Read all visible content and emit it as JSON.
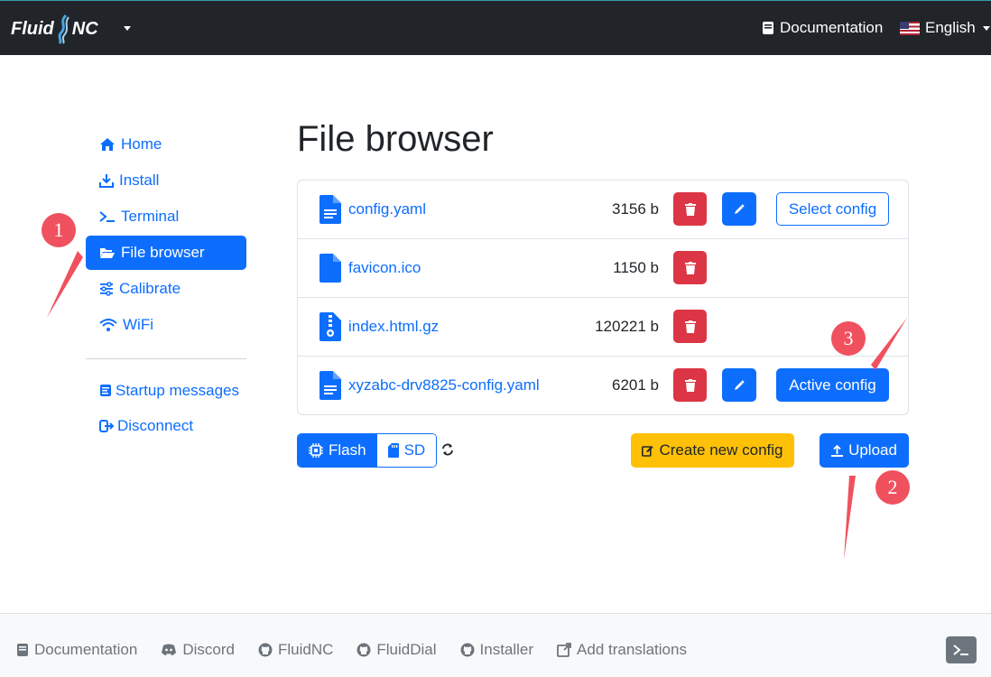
{
  "navbar": {
    "brand": "Fluid NC",
    "documentation": "Documentation",
    "language": "English",
    "icons": {
      "doc": "book-icon",
      "flag": "us-flag-icon"
    }
  },
  "sidebar": {
    "items": [
      {
        "label": "Home",
        "icon": "home-icon"
      },
      {
        "label": "Install",
        "icon": "download-icon"
      },
      {
        "label": "Terminal",
        "icon": "terminal-icon"
      },
      {
        "label": "File browser",
        "icon": "folder-open-icon",
        "active": true
      },
      {
        "label": "Calibrate",
        "icon": "sliders-icon"
      },
      {
        "label": "WiFi",
        "icon": "wifi-icon"
      }
    ],
    "startup": "Startup messages",
    "disconnect": "Disconnect"
  },
  "page": {
    "title": "File browser"
  },
  "files": [
    {
      "name": "config.yaml",
      "size": "3156 b",
      "editable": true,
      "config_label": "Select config",
      "config_state": "outline"
    },
    {
      "name": "favicon.ico",
      "size": "1150 b",
      "editable": false
    },
    {
      "name": "index.html.gz",
      "size": "120221 b",
      "editable": false
    },
    {
      "name": "xyzabc-drv8825-config.yaml",
      "size": "6201 b",
      "editable": true,
      "config_label": "Active config",
      "config_state": "solid"
    }
  ],
  "storage": {
    "flash": "Flash",
    "sd": "SD",
    "selected": "Flash"
  },
  "actions": {
    "create": "Create new config",
    "upload": "Upload"
  },
  "annotations": {
    "m1": "1",
    "m2": "2",
    "m3": "3"
  },
  "footer": {
    "links": [
      {
        "label": "Documentation",
        "icon": "book-icon"
      },
      {
        "label": "Discord",
        "icon": "discord-icon"
      },
      {
        "label": "FluidNC",
        "icon": "github-icon"
      },
      {
        "label": "FluidDial",
        "icon": "github-icon"
      },
      {
        "label": "Installer",
        "icon": "github-icon"
      },
      {
        "label": "Add translations",
        "icon": "external-link-icon"
      }
    ]
  },
  "colors": {
    "primary": "#0d6efd",
    "danger": "#dc3545",
    "warning": "#ffc107",
    "navbar": "#212529",
    "marker": "#f0515e"
  }
}
